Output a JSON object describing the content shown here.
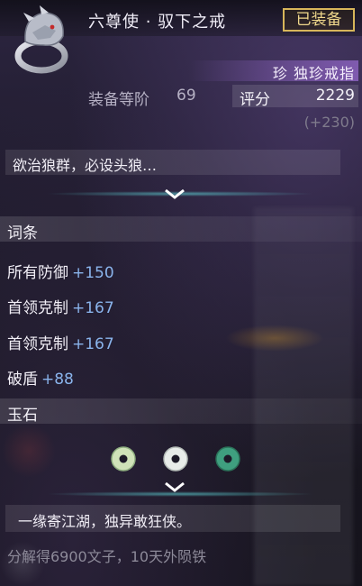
{
  "item": {
    "name": "六尊使 · 驭下之戒",
    "equipped_label": "已装备",
    "rarity_label": "珍 独珍戒指",
    "tier_label": "装备等阶",
    "tier_value": "69",
    "score_label": "评分",
    "score_value": "2229",
    "score_delta": "(+230)",
    "flavor": "欲治狼群，必设头狼…",
    "icon": "ring-icon"
  },
  "affixes": {
    "title": "词条",
    "rows": [
      {
        "name": "所有防御",
        "value": "+150"
      },
      {
        "name": "首领克制",
        "value": "+167"
      },
      {
        "name": "首领克制",
        "value": "+167"
      },
      {
        "name": "破盾",
        "value": "+88"
      }
    ]
  },
  "jades": {
    "title": "玉石",
    "slots": [
      {
        "icon": "jade-disc-icon",
        "color": "#cfe2b8"
      },
      {
        "icon": "jade-disc-icon",
        "color": "#e8ece9"
      },
      {
        "icon": "jade-disc-icon",
        "color": "#3f9f7f"
      }
    ]
  },
  "motto": "一缘寄江湖，独异敢狂侠。",
  "salvage": "分解得6900文子，10天外陨铁",
  "colors": {
    "accent_gold": "#d7b65a",
    "stat_value": "#8ab4ec",
    "rarity_purple": "#9669cd"
  }
}
